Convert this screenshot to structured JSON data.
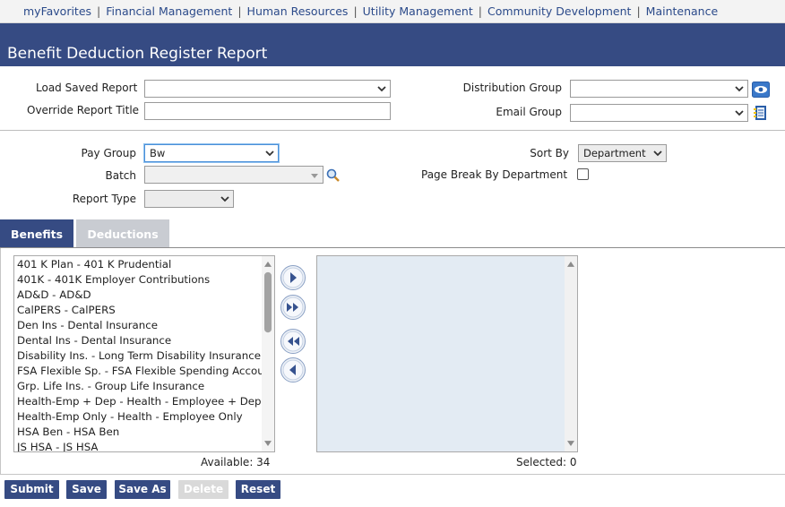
{
  "nav": {
    "items": [
      "myFavorites",
      "Financial Management",
      "Human Resources",
      "Utility Management",
      "Community Development",
      "Maintenance"
    ],
    "separator": "|"
  },
  "header": {
    "title": "Benefit Deduction Register Report"
  },
  "report": {
    "load_saved_label": "Load Saved Report",
    "load_saved_value": "",
    "override_title_label": "Override Report Title",
    "override_title_value": "",
    "distribution_group_label": "Distribution Group",
    "distribution_group_value": "",
    "email_group_label": "Email Group",
    "email_group_value": ""
  },
  "criteria": {
    "pay_group_label": "Pay Group",
    "pay_group_value": "Bw",
    "batch_label": "Batch",
    "batch_value": "",
    "report_type_label": "Report Type",
    "report_type_value": "",
    "sort_by_label": "Sort By",
    "sort_by_value": "Department",
    "page_break_label": "Page Break By Department",
    "page_break_checked": false
  },
  "tabs": [
    {
      "label": "Benefits",
      "active": true
    },
    {
      "label": "Deductions",
      "active": false
    }
  ],
  "available": {
    "items": [
      "401 K Plan - 401 K Prudential",
      "401K - 401K Employer Contributions",
      "AD&D - AD&D",
      "CalPERS - CalPERS",
      "Den Ins - Dental Insurance",
      "Dental Ins - Dental Insurance",
      "Disability Ins. - Long Term Disability Insurance",
      "FSA Flexible Sp. - FSA Flexible Spending Account",
      "Grp. Life Ins. - Group Life Insurance",
      "Health-Emp + Dep - Health - Employee + Dependent",
      "Health-Emp Only - Health - Employee Only",
      "HSA Ben - HSA Ben",
      "JS HSA - JS HSA"
    ],
    "count_label": "Available: 34"
  },
  "selected": {
    "items": [],
    "count_label": "Selected: 0"
  },
  "buttons": {
    "submit": "Submit",
    "save": "Save",
    "save_as": "Save As",
    "delete": "Delete",
    "reset": "Reset"
  },
  "colors": {
    "brand": "#364b83",
    "nav_link": "#2b4a8a",
    "tab_inactive": "#c9ccd2",
    "selected_list_bg": "#e3ebf3"
  },
  "icons": {
    "view_distribution": "eye-icon",
    "email_group": "address-book-icon",
    "batch_lookup": "magnifier-icon",
    "move_right": "arrow-right-icon",
    "move_all_right": "double-arrow-right-icon",
    "move_all_left": "double-arrow-left-icon",
    "move_left": "arrow-left-icon"
  }
}
